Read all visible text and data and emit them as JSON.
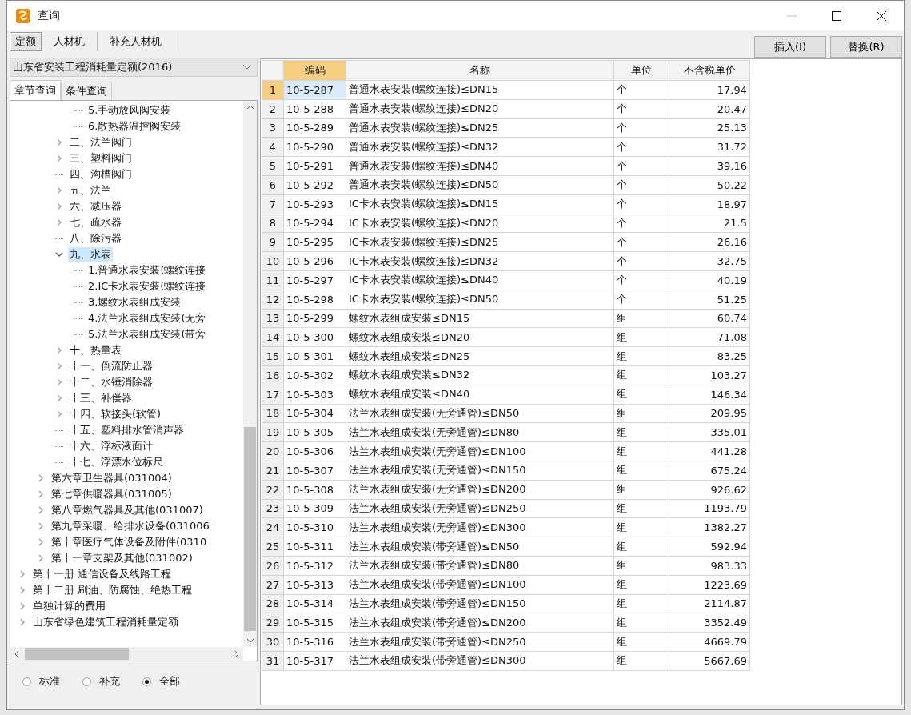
{
  "window": {
    "title": "查询"
  },
  "tabs": [
    {
      "label": "定额",
      "selected": true
    },
    {
      "label": "人材机",
      "selected": false
    },
    {
      "label": "补充人材机",
      "selected": false
    }
  ],
  "buttons": [
    "插入(I)",
    "替换(R)"
  ],
  "library_select": {
    "value": "山东省安装工程消耗量定额(2016)"
  },
  "subtabs": [
    {
      "label": "章节查询",
      "selected": true
    },
    {
      "label": "条件查询",
      "selected": false
    }
  ],
  "tree": {
    "items": [
      {
        "children": [
          {
            "children": [
              {
                "children": [
                  {
                    "label": "5.手动放风阀安装",
                    "selected": false
                  },
                  {
                    "label": "6.散热器温控阀安装",
                    "selected": false
                  }
                ]
              },
              {
                "label": "二、法兰阀门",
                "expanded": false,
                "selected": false
              },
              {
                "label": "三、塑料阀门",
                "expanded": false,
                "selected": false
              },
              {
                "label": "四、沟槽阀门",
                "selected": false
              },
              {
                "label": "五、法兰",
                "expanded": false,
                "selected": false
              },
              {
                "label": "六、减压器",
                "expanded": false,
                "selected": false
              },
              {
                "label": "七、疏水器",
                "expanded": false,
                "selected": false
              },
              {
                "label": "八、除污器",
                "selected": false
              },
              {
                "label": "九、水表",
                "expanded": true,
                "selected": true,
                "children": [
                  {
                    "label": "1.普通水表安装(螺纹连接",
                    "selected": false
                  },
                  {
                    "label": "2.IC卡水表安装(螺纹连接",
                    "selected": false
                  },
                  {
                    "label": "3.螺纹水表组成安装",
                    "selected": false
                  },
                  {
                    "label": "4.法兰水表组成安装(无旁",
                    "selected": false
                  },
                  {
                    "label": "5.法兰水表组成安装(带旁",
                    "selected": false
                  }
                ]
              },
              {
                "label": "十、热量表",
                "expanded": false,
                "selected": false
              },
              {
                "label": "十一、倒流防止器",
                "expanded": false,
                "selected": false
              },
              {
                "label": "十二、水锤消除器",
                "expanded": false,
                "selected": false
              },
              {
                "label": "十三、补偿器",
                "expanded": false,
                "selected": false
              },
              {
                "label": "十四、软接头(软管)",
                "expanded": false,
                "selected": false
              },
              {
                "label": "十五、塑料排水管消声器",
                "selected": false
              },
              {
                "label": "十六、浮标液面计",
                "selected": false
              },
              {
                "label": "十七、浮漂水位标尺",
                "selected": false
              }
            ]
          },
          {
            "label": "第六章卫生器具(031004)",
            "expanded": false,
            "selected": false
          },
          {
            "label": "第七章供暖器具(031005)",
            "expanded": false,
            "selected": false
          },
          {
            "label": "第八章燃气器具及其他(031007)",
            "expanded": false,
            "selected": false
          },
          {
            "label": "第九章采暖、给排水设备(031006",
            "expanded": false,
            "selected": false
          },
          {
            "label": "第十章医疗气体设备及附件(0310",
            "expanded": false,
            "selected": false
          },
          {
            "label": "第十一章支架及其他(031002)",
            "expanded": false,
            "selected": false
          }
        ]
      },
      {
        "label": "第十一册 通信设备及线路工程",
        "expanded": false,
        "selected": false
      },
      {
        "label": "第十二册 刷油、防腐蚀、绝热工程",
        "expanded": false,
        "selected": false
      },
      {
        "label": "单独计算的费用",
        "expanded": false,
        "selected": false
      },
      {
        "label": "山东省绿色建筑工程消耗量定额",
        "expanded": false,
        "selected": false
      }
    ]
  },
  "filter": [
    {
      "label": "标准",
      "selected": false
    },
    {
      "label": "补充",
      "selected": false
    },
    {
      "label": "全部",
      "selected": true
    }
  ],
  "table": {
    "columns": [
      {
        "label": "编码",
        "selected": true
      },
      {
        "label": "名称",
        "selected": false
      },
      {
        "label": "单位",
        "selected": false
      },
      {
        "label": "不含税单价",
        "selected": false
      }
    ],
    "rows": [
      {
        "no": "1",
        "code": "10-5-287",
        "name": "普通水表安装(螺纹连接)≤DN15",
        "unit": "个",
        "price": "17.94",
        "selected": true
      },
      {
        "no": "2",
        "code": "10-5-288",
        "name": "普通水表安装(螺纹连接)≤DN20",
        "unit": "个",
        "price": "20.47",
        "selected": false
      },
      {
        "no": "3",
        "code": "10-5-289",
        "name": "普通水表安装(螺纹连接)≤DN25",
        "unit": "个",
        "price": "25.13",
        "selected": false
      },
      {
        "no": "4",
        "code": "10-5-290",
        "name": "普通水表安装(螺纹连接)≤DN32",
        "unit": "个",
        "price": "31.72",
        "selected": false
      },
      {
        "no": "5",
        "code": "10-5-291",
        "name": "普通水表安装(螺纹连接)≤DN40",
        "unit": "个",
        "price": "39.16",
        "selected": false
      },
      {
        "no": "6",
        "code": "10-5-292",
        "name": "普通水表安装(螺纹连接)≤DN50",
        "unit": "个",
        "price": "50.22",
        "selected": false
      },
      {
        "no": "7",
        "code": "10-5-293",
        "name": "IC卡水表安装(螺纹连接)≤DN15",
        "unit": "个",
        "price": "18.97",
        "selected": false
      },
      {
        "no": "8",
        "code": "10-5-294",
        "name": "IC卡水表安装(螺纹连接)≤DN20",
        "unit": "个",
        "price": "21.5",
        "selected": false
      },
      {
        "no": "9",
        "code": "10-5-295",
        "name": "IC卡水表安装(螺纹连接)≤DN25",
        "unit": "个",
        "price": "26.16",
        "selected": false
      },
      {
        "no": "10",
        "code": "10-5-296",
        "name": "IC卡水表安装(螺纹连接)≤DN32",
        "unit": "个",
        "price": "32.75",
        "selected": false
      },
      {
        "no": "11",
        "code": "10-5-297",
        "name": "IC卡水表安装(螺纹连接)≤DN40",
        "unit": "个",
        "price": "40.19",
        "selected": false
      },
      {
        "no": "12",
        "code": "10-5-298",
        "name": "IC卡水表安装(螺纹连接)≤DN50",
        "unit": "个",
        "price": "51.25",
        "selected": false
      },
      {
        "no": "13",
        "code": "10-5-299",
        "name": "螺纹水表组成安装≤DN15",
        "unit": "组",
        "price": "60.74",
        "selected": false
      },
      {
        "no": "14",
        "code": "10-5-300",
        "name": "螺纹水表组成安装≤DN20",
        "unit": "组",
        "price": "71.08",
        "selected": false
      },
      {
        "no": "15",
        "code": "10-5-301",
        "name": "螺纹水表组成安装≤DN25",
        "unit": "组",
        "price": "83.25",
        "selected": false
      },
      {
        "no": "16",
        "code": "10-5-302",
        "name": "螺纹水表组成安装≤DN32",
        "unit": "组",
        "price": "103.27",
        "selected": false
      },
      {
        "no": "17",
        "code": "10-5-303",
        "name": "螺纹水表组成安装≤DN40",
        "unit": "组",
        "price": "146.34",
        "selected": false
      },
      {
        "no": "18",
        "code": "10-5-304",
        "name": "法兰水表组成安装(无旁通管)≤DN50",
        "unit": "组",
        "price": "209.95",
        "selected": false
      },
      {
        "no": "19",
        "code": "10-5-305",
        "name": "法兰水表组成安装(无旁通管)≤DN80",
        "unit": "组",
        "price": "335.01",
        "selected": false
      },
      {
        "no": "20",
        "code": "10-5-306",
        "name": "法兰水表组成安装(无旁通管)≤DN100",
        "unit": "组",
        "price": "441.28",
        "selected": false
      },
      {
        "no": "21",
        "code": "10-5-307",
        "name": "法兰水表组成安装(无旁通管)≤DN150",
        "unit": "组",
        "price": "675.24",
        "selected": false
      },
      {
        "no": "22",
        "code": "10-5-308",
        "name": "法兰水表组成安装(无旁通管)≤DN200",
        "unit": "组",
        "price": "926.62",
        "selected": false
      },
      {
        "no": "23",
        "code": "10-5-309",
        "name": "法兰水表组成安装(无旁通管)≤DN250",
        "unit": "组",
        "price": "1193.79",
        "selected": false
      },
      {
        "no": "24",
        "code": "10-5-310",
        "name": "法兰水表组成安装(无旁通管)≤DN300",
        "unit": "组",
        "price": "1382.27",
        "selected": false
      },
      {
        "no": "25",
        "code": "10-5-311",
        "name": "法兰水表组成安装(带旁通管)≤DN50",
        "unit": "组",
        "price": "592.94",
        "selected": false
      },
      {
        "no": "26",
        "code": "10-5-312",
        "name": "法兰水表组成安装(带旁通管)≤DN80",
        "unit": "组",
        "price": "983.33",
        "selected": false
      },
      {
        "no": "27",
        "code": "10-5-313",
        "name": "法兰水表组成安装(带旁通管)≤DN100",
        "unit": "组",
        "price": "1223.69",
        "selected": false
      },
      {
        "no": "28",
        "code": "10-5-314",
        "name": "法兰水表组成安装(带旁通管)≤DN150",
        "unit": "组",
        "price": "2114.87",
        "selected": false
      },
      {
        "no": "29",
        "code": "10-5-315",
        "name": "法兰水表组成安装(带旁通管)≤DN200",
        "unit": "组",
        "price": "3352.49",
        "selected": false
      },
      {
        "no": "30",
        "code": "10-5-316",
        "name": "法兰水表组成安装(带旁通管)≤DN250",
        "unit": "组",
        "price": "4669.79",
        "selected": false
      },
      {
        "no": "31",
        "code": "10-5-317",
        "name": "法兰水表组成安装(带旁通管)≤DN300",
        "unit": "组",
        "price": "5667.69",
        "selected": false
      }
    ]
  }
}
